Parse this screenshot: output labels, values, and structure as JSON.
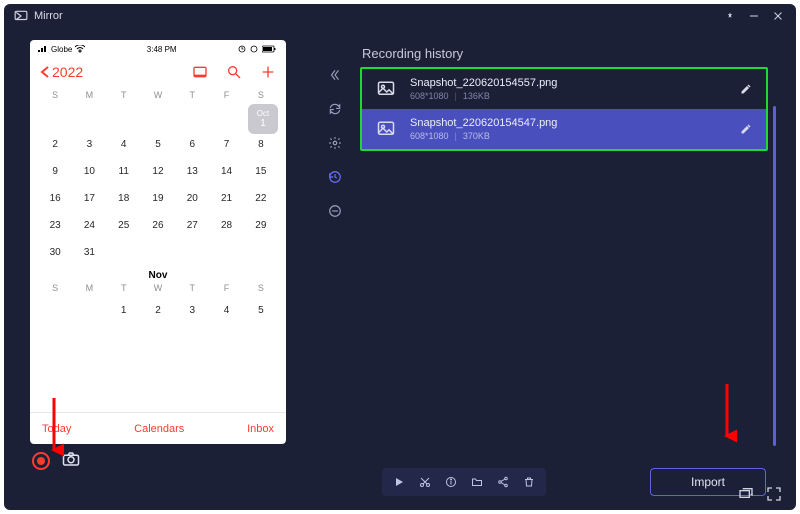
{
  "window": {
    "title": "Mirror"
  },
  "phone": {
    "carrier": "Globe",
    "time": "3:48 PM",
    "year_label": "2022",
    "oct_label": "Oct",
    "oct_day": "1",
    "weekdays": [
      "S",
      "M",
      "T",
      "W",
      "T",
      "F",
      "S"
    ],
    "oct_grid": [
      [
        "",
        "",
        "",
        "",
        "",
        "",
        ""
      ],
      [
        "2",
        "3",
        "4",
        "5",
        "6",
        "7",
        "8"
      ],
      [
        "9",
        "10",
        "11",
        "12",
        "13",
        "14",
        "15"
      ],
      [
        "16",
        "17",
        "18",
        "19",
        "20",
        "21",
        "22"
      ],
      [
        "23",
        "24",
        "25",
        "26",
        "27",
        "28",
        "29"
      ],
      [
        "30",
        "31",
        "",
        "",
        "",
        "",
        ""
      ]
    ],
    "nov_label": "Nov",
    "nov_grid": [
      [
        "",
        "",
        "1",
        "2",
        "3",
        "4",
        "5"
      ]
    ],
    "footer": {
      "today": "Today",
      "calendars": "Calendars",
      "inbox": "Inbox"
    }
  },
  "panel": {
    "title": "Recording history",
    "items": [
      {
        "name": "Snapshot_220620154557.png",
        "dims": "608*1080",
        "size": "136KB",
        "selected": false
      },
      {
        "name": "Snapshot_220620154547.png",
        "dims": "608*1080",
        "size": "370KB",
        "selected": true
      }
    ],
    "import_btn": "Import"
  }
}
